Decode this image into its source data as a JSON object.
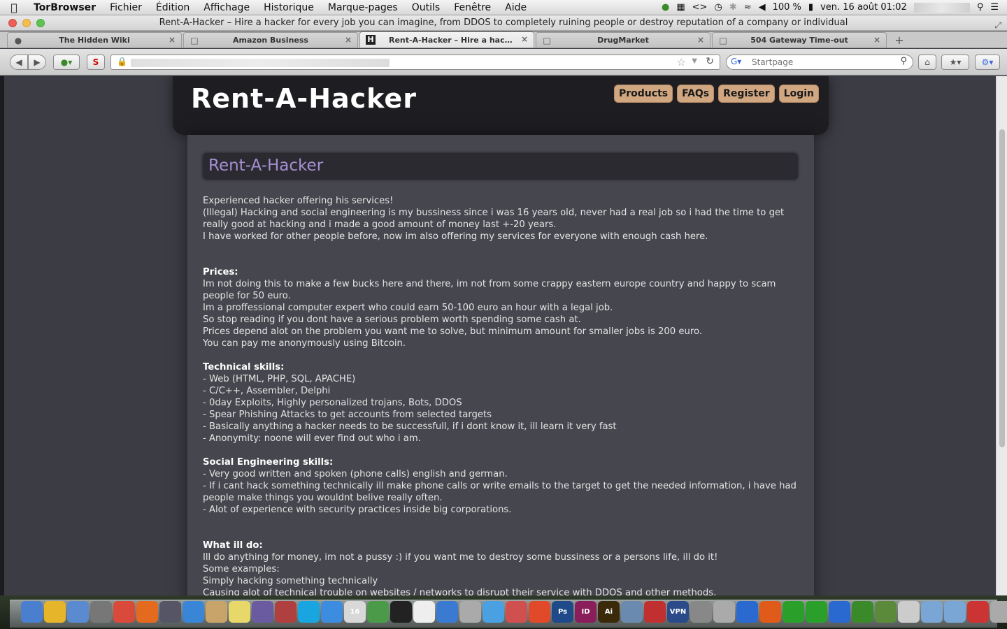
{
  "menubar": {
    "app_name": "TorBrowser",
    "items": [
      "Fichier",
      "Édition",
      "Affichage",
      "Historique",
      "Marque-pages",
      "Outils",
      "Fenêtre",
      "Aide"
    ],
    "battery": "100 %",
    "clock": "ven. 16 août  01:02"
  },
  "window": {
    "title": "Rent-A-Hacker – Hire a hacker for every job you can imagine, from DDOS to completely ruining people or destroy reputation of a company or individual"
  },
  "tabs": [
    {
      "label": "The Hidden Wiki",
      "icon": "tor-onion-icon"
    },
    {
      "label": "Amazon Business",
      "icon": "blank-page-icon"
    },
    {
      "label": "Rent-A-Hacker – Hire a hacker ...",
      "icon": "h-favicon-icon",
      "active": true
    },
    {
      "label": "DrugMarket",
      "icon": "blank-page-icon"
    },
    {
      "label": "504 Gateway Time-out",
      "icon": "blank-page-icon"
    }
  ],
  "search": {
    "placeholder": "Startpage"
  },
  "site": {
    "logo": "Rent-A-Hacker",
    "nav": [
      "Products",
      "FAQs",
      "Register",
      "Login"
    ],
    "page_title": "Rent-A-Hacker"
  },
  "content": {
    "intro": [
      "Experienced hacker offering his services!",
      "(Illegal) Hacking and social engineering is my bussiness since i was 16 years old, never had a real job so i had the time to get really good at hacking and i made a good amount of money last +-20 years.",
      "I have worked for other people before, now im also offering my services for everyone with enough cash here."
    ],
    "prices_heading": "Prices:",
    "prices": [
      "Im not doing this to make a few bucks here and there, im not from some crappy eastern europe country and happy to scam people for 50 euro.",
      "Im a proffessional computer expert who could earn 50-100 euro an hour with a legal job.",
      "So stop reading if you dont have a serious problem worth spending some cash at.",
      "Prices depend alot on the problem you want me to solve, but minimum amount for smaller jobs is 200 euro.",
      "You can pay me anonymously using Bitcoin."
    ],
    "tech_heading": "Technical skills:",
    "tech": [
      "- Web (HTML, PHP, SQL, APACHE)",
      "- C/C++, Assembler, Delphi",
      "- 0day Exploits, Highly personalized trojans, Bots, DDOS",
      "- Spear Phishing Attacks to get accounts from selected targets",
      "- Basically anything a hacker needs to be successfull, if i dont know it, ill learn it very fast",
      "- Anonymity: noone will ever find out who i am."
    ],
    "social_heading": "Social Engineering skills:",
    "social": [
      "- Very good written and spoken (phone calls) english and german.",
      "- If i cant hack something technically ill make phone calls or write emails to the target to get the needed information, i have had people make things you wouldnt belive really often.",
      "- Alot of experience with security practices inside big corporations."
    ],
    "whatido_heading": "What ill do:",
    "whatido": [
      "Ill do anything for money, im not a pussy :) if you want me to destroy some bussiness or a persons life, ill do it!",
      "Some examples:",
      "Simply hacking something technically",
      "Causing alot of technical trouble on websites / networks to disrupt their service with DDOS and other methods."
    ]
  },
  "dock": {
    "icons": [
      "finder-icon",
      "adium-icon",
      "preview-icon",
      "launchpad-icon",
      "chrome-icon",
      "firefox-icon",
      "system-monitor-icon",
      "app-store-icon",
      "contacts-icon",
      "stickies-icon",
      "feather-icon",
      "photo-icon",
      "skype-icon",
      "dropbox-icon",
      "calendar-icon",
      "grapher-icon",
      "p-app-icon",
      "textedit-icon",
      "network-icon",
      "mail-icon",
      "itunes-icon",
      "flashcard-icon",
      "burst-icon",
      "photoshop-icon",
      "indesign-icon",
      "illustrator-icon",
      "monitor-icon",
      "flag-icon",
      "vpn-icon",
      "tools-icon",
      "people-icon",
      "word-icon",
      "p-icon",
      "x-icon",
      "utorrent-icon",
      "bird-icon",
      "tor-onion-icon",
      "globe-icon",
      "pen-icon",
      "folder-icon",
      "folder-icon",
      "flag-icon",
      "trash-icon"
    ],
    "labels": {
      "photoshop": "Ps",
      "indesign": "ID",
      "illustrator": "Ai",
      "vpn": "VPN",
      "calendar": "16"
    }
  }
}
